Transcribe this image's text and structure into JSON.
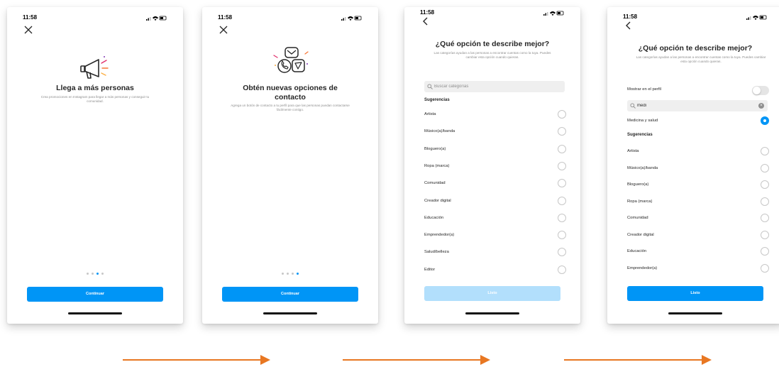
{
  "colors": {
    "accent": "#0095f6",
    "accent_disabled": "#b2dffc",
    "arrow": "#e87722"
  },
  "screens": [
    {
      "status_time": "11:58",
      "nav_icon": "close-icon",
      "illustration": "megaphone-icon",
      "title": "Llega a más personas",
      "subtitle": "Crea promociones en Instagram para llegar a más personas y conseguir tu comunidad.",
      "button": "Continuar",
      "page_dots": {
        "total": 4,
        "active": 3
      }
    },
    {
      "status_time": "11:58",
      "nav_icon": "close-icon",
      "illustration": "contact-options-icon",
      "title": "Obtén nuevas opciones de contacto",
      "subtitle": "Agrega un botón de contacto a tu perfil para que las personas puedan contactarse fácilmente contigo.",
      "button": "Continuar",
      "page_dots": {
        "total": 4,
        "active": 4
      }
    },
    {
      "status_time": "11:58",
      "nav_icon": "back-chevron-icon",
      "title": "¿Qué opción te describe mejor?",
      "subtitle": "Las categorías ayudan a las personas a encontrar cuentas como la tuya. Puedes cambiar esta opción cuando quieras.",
      "search_placeholder": "Buscar categorías",
      "section": "Sugerencias",
      "options": [
        "Artista",
        "Músico(a)/banda",
        "Bloguero(a)",
        "Ropa (marca)",
        "Comunidad",
        "Creador digital",
        "Educación",
        "Emprendedor(a)",
        "Salud/belleza",
        "Editor"
      ],
      "button": "Listo",
      "button_disabled": true
    },
    {
      "status_time": "11:58",
      "nav_icon": "back-chevron-icon",
      "title": "¿Qué opción te describe mejor?",
      "subtitle": "Las categorías ayudan a las personas a encontrar cuentas como la tuya. Puedes cambiar esta opción cuando quieras.",
      "toggle_label": "Mostrar en el perfil",
      "toggle_on": false,
      "search_value": "medi",
      "selected_option": "Medicina y salud",
      "section": "Sugerencias",
      "options": [
        "Artista",
        "Músico(a)/banda",
        "Bloguero(a)",
        "Ropa (marca)",
        "Comunidad",
        "Creador digital",
        "Educación",
        "Emprendedor(a)"
      ],
      "button": "Listo",
      "button_disabled": false
    }
  ]
}
